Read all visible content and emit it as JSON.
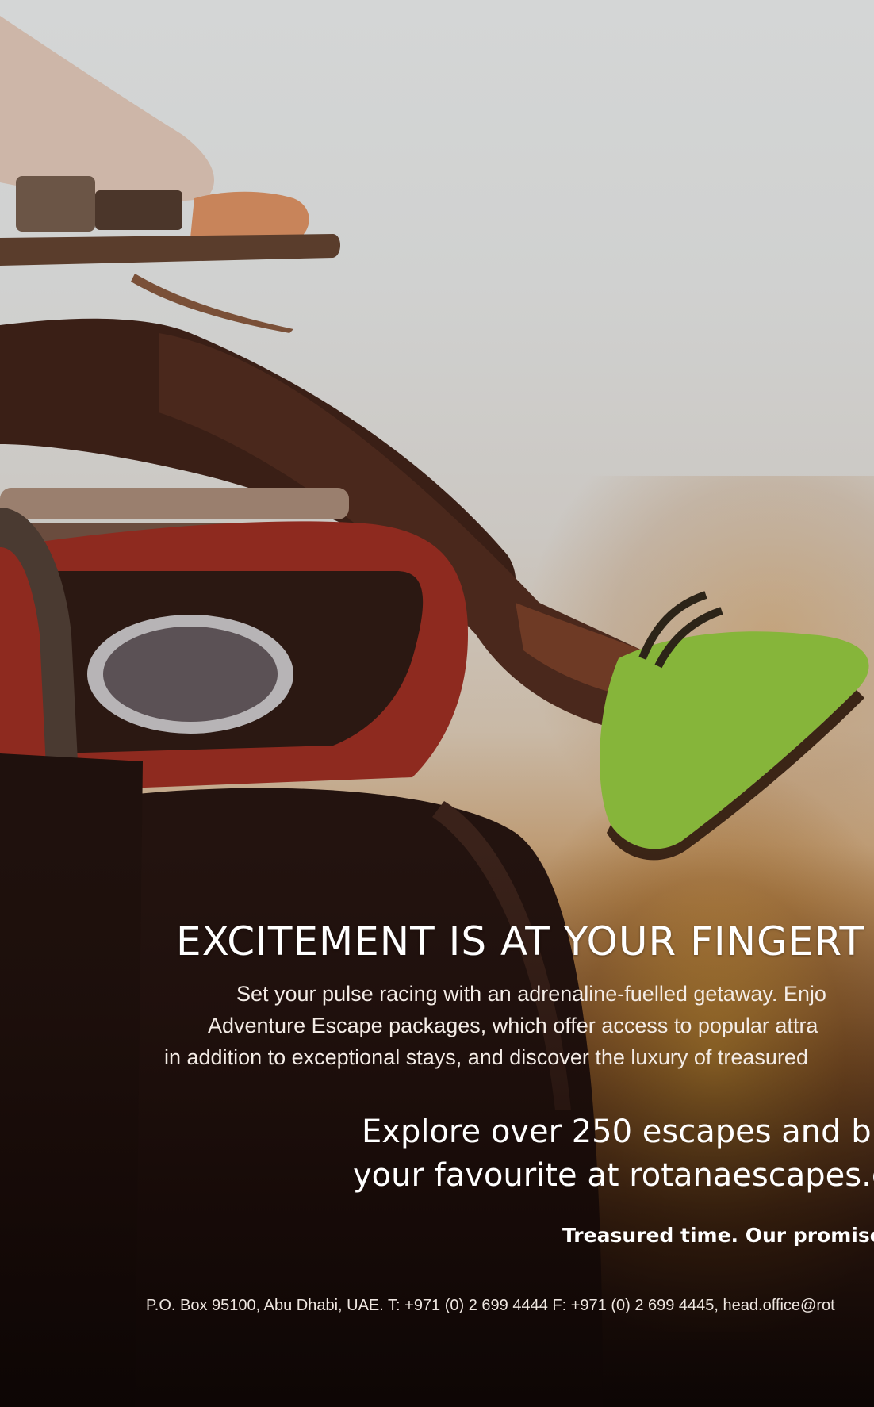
{
  "hero_image": {
    "subject": "rider on a red quad bike with green sneakers in the desert"
  },
  "headline": "EXCITEMENT IS AT YOUR FINGERT",
  "body_lines": [
    "Set your pulse racing with an adrenaline-fuelled getaway. Enjo",
    "Adventure Escape packages, which offer access to popular attra",
    "in addition to exceptional stays, and discover the luxury of treasured"
  ],
  "cta_lines": [
    "Explore over 250 escapes and b",
    "your favourite at rotanaescapes.c"
  ],
  "tagline": "Treasured time. Our promise t",
  "address": "P.O. Box 95100, Abu Dhabi, UAE. T: +971 (0) 2 699 4444 F: +971 (0) 2 699 4445, head.office@rot",
  "colors": {
    "sky_top": "#d4d6d6",
    "sand_glow": "#ce9632",
    "bike_red": "#8e2a1f",
    "sneaker_green": "#86b53a",
    "text": "#ffffff"
  }
}
